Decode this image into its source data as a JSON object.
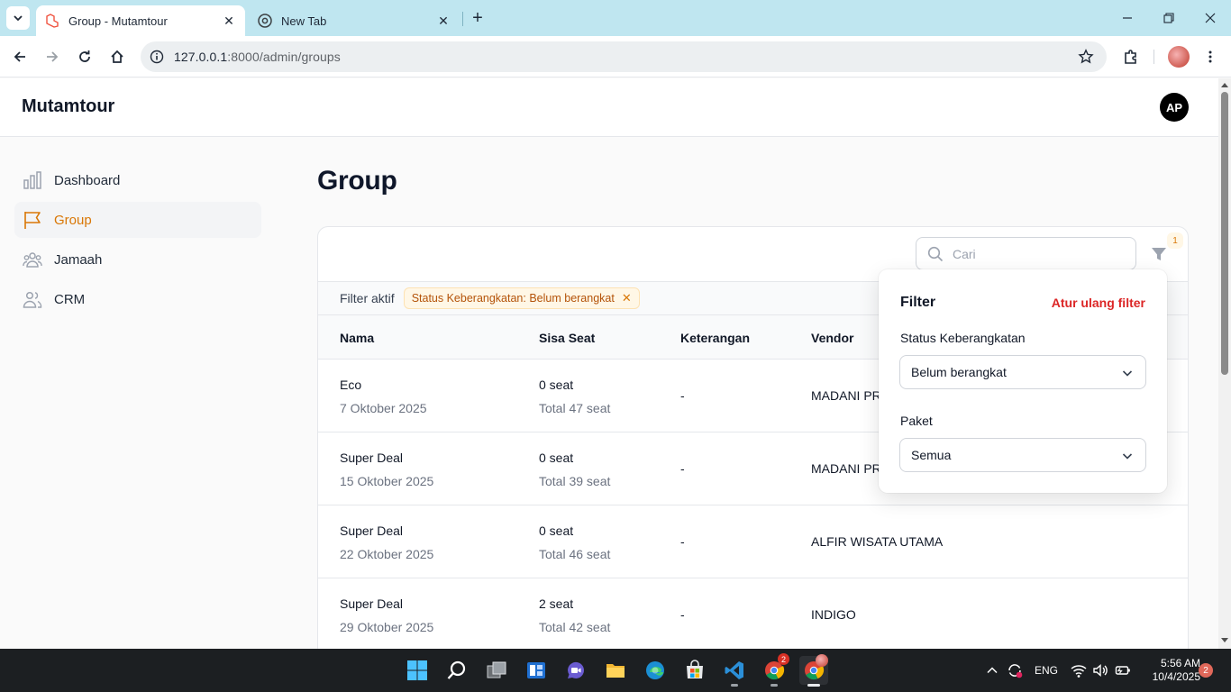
{
  "browser": {
    "tabs": [
      {
        "title": "Group - Mutamtour",
        "active": true
      },
      {
        "title": "New Tab",
        "active": false
      }
    ],
    "url_host": "127.0.0.1",
    "url_path": ":8000/admin/groups"
  },
  "app": {
    "brand": "Mutamtour",
    "user_initials": "AP"
  },
  "sidebar": {
    "items": [
      {
        "label": "Dashboard",
        "icon": "chart-bar-icon",
        "active": false
      },
      {
        "label": "Group",
        "icon": "flag-icon",
        "active": true
      },
      {
        "label": "Jamaah",
        "icon": "user-group-icon",
        "active": false
      },
      {
        "label": "CRM",
        "icon": "users-icon",
        "active": false
      }
    ]
  },
  "main": {
    "title": "Group",
    "search_placeholder": "Cari",
    "filter_count": "1",
    "active_filters_label": "Filter aktif",
    "active_filter_chip": "Status Keberangkatan: Belum berangkat",
    "columns": [
      "Nama",
      "Sisa Seat",
      "Keterangan",
      "Vendor"
    ],
    "rows": [
      {
        "name": "Eco",
        "date": "7 Oktober 2025",
        "seat": "0 seat",
        "total": "Total 47 seat",
        "note": "-",
        "vendor": "MADANI PR"
      },
      {
        "name": "Super Deal",
        "date": "15 Oktober 2025",
        "seat": "0 seat",
        "total": "Total 39 seat",
        "note": "-",
        "vendor": "MADANI PR"
      },
      {
        "name": "Super Deal",
        "date": "22 Oktober 2025",
        "seat": "0 seat",
        "total": "Total 46 seat",
        "note": "-",
        "vendor": "ALFIR WISATA UTAMA"
      },
      {
        "name": "Super Deal",
        "date": "29 Oktober 2025",
        "seat": "2 seat",
        "total": "Total 42 seat",
        "note": "-",
        "vendor": "INDIGO"
      }
    ]
  },
  "filter_panel": {
    "title": "Filter",
    "reset_label": "Atur ulang filter",
    "status_label": "Status Keberangkatan",
    "status_value": "Belum berangkat",
    "package_label": "Paket",
    "package_value": "Semua"
  },
  "taskbar": {
    "language": "ENG",
    "time": "5:56 AM",
    "date": "10/4/2025",
    "notification_count": "2",
    "chrome_badge": "2"
  },
  "colors": {
    "accent": "#d97706",
    "danger": "#dc2626",
    "tabbar": "#bfe6f0"
  }
}
